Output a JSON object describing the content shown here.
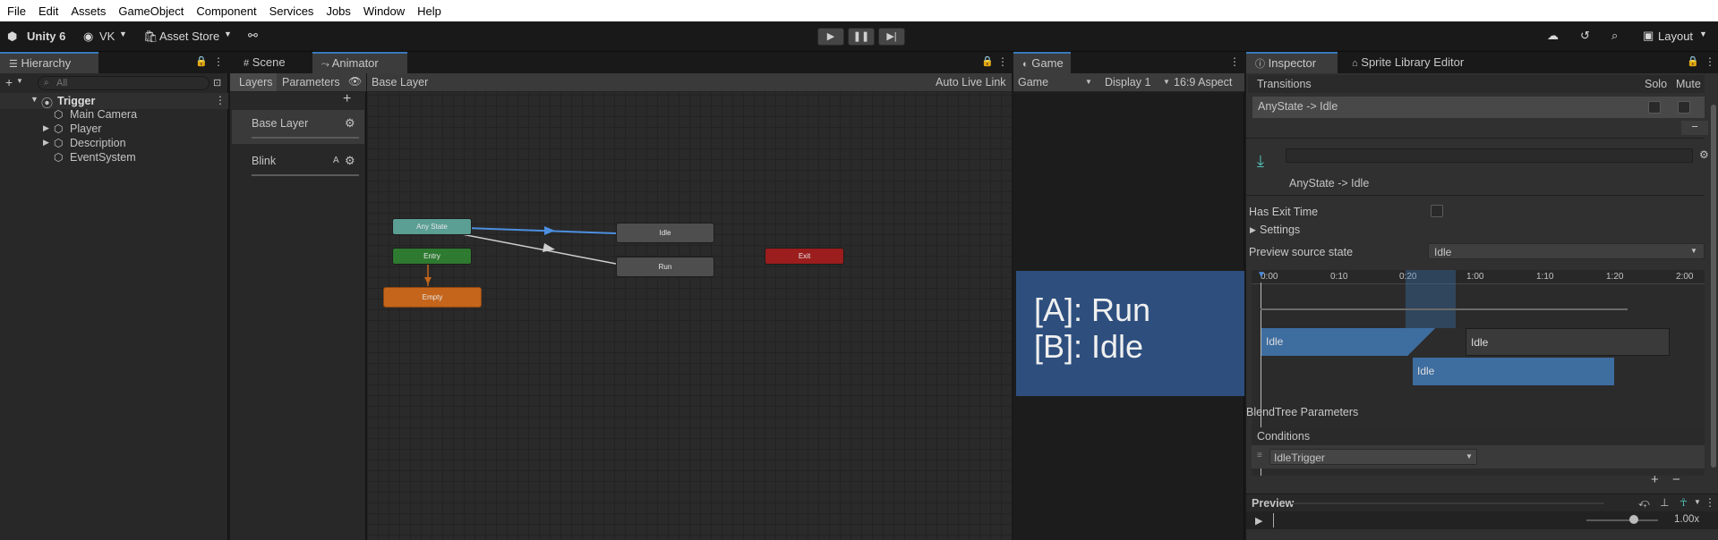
{
  "menu": [
    "File",
    "Edit",
    "Assets",
    "GameObject",
    "Component",
    "Services",
    "Jobs",
    "Window",
    "Help"
  ],
  "toolbar": {
    "unity_label": "Unity 6",
    "account": "VK",
    "asset_store": "Asset Store",
    "layout": "Layout"
  },
  "hierarchy": {
    "tab": "Hierarchy",
    "search_placeholder": "All",
    "scene": "Trigger",
    "items": [
      "Main Camera",
      "Player",
      "Description",
      "EventSystem"
    ]
  },
  "animator": {
    "tabs": [
      "Scene",
      "Animator"
    ],
    "subtabs": [
      "Layers",
      "Parameters"
    ],
    "breadcrumb": "Base Layer",
    "auto_live_link": "Auto Live Link",
    "layers": [
      {
        "name": "Base Layer",
        "badge": ""
      },
      {
        "name": "Blink",
        "badge": "A"
      }
    ],
    "nodes": {
      "any_state": "Any State",
      "entry": "Entry",
      "empty": "Empty",
      "idle": "Idle",
      "run": "Run",
      "exit": "Exit"
    }
  },
  "game": {
    "tab": "Game",
    "mode": "Game",
    "display": "Display 1",
    "aspect": "16:9 Aspect",
    "line1": "[A]: Run",
    "line2": "[B]: Idle"
  },
  "inspector": {
    "tabs": [
      "Inspector",
      "Sprite Library Editor"
    ],
    "transitions_header": "Transitions",
    "solo": "Solo",
    "mute": "Mute",
    "transition_item": "AnyState -> Idle",
    "title": "AnyState -> Idle",
    "has_exit_time": "Has Exit Time",
    "settings": "Settings",
    "preview_source_state": "Preview source state",
    "preview_value": "Idle",
    "timeline_ticks": [
      "0:00",
      "0:10",
      "0:20",
      "1:00",
      "1:10",
      "1:20",
      "2:00"
    ],
    "clips": [
      "Idle",
      "Idle",
      "Idle"
    ],
    "blendtree": "BlendTree Parameters",
    "conditions": "Conditions",
    "condition_value": "IdleTrigger",
    "preview": "Preview",
    "speed": "1.00x"
  },
  "colors": {
    "accent": "#3a79bb",
    "any_state": "#5a9e94",
    "entry": "#2f7a31",
    "empty": "#c4651b",
    "exit": "#9b1d1d",
    "game_bg": "#2e4f7e",
    "clip": "#3e6da0"
  }
}
